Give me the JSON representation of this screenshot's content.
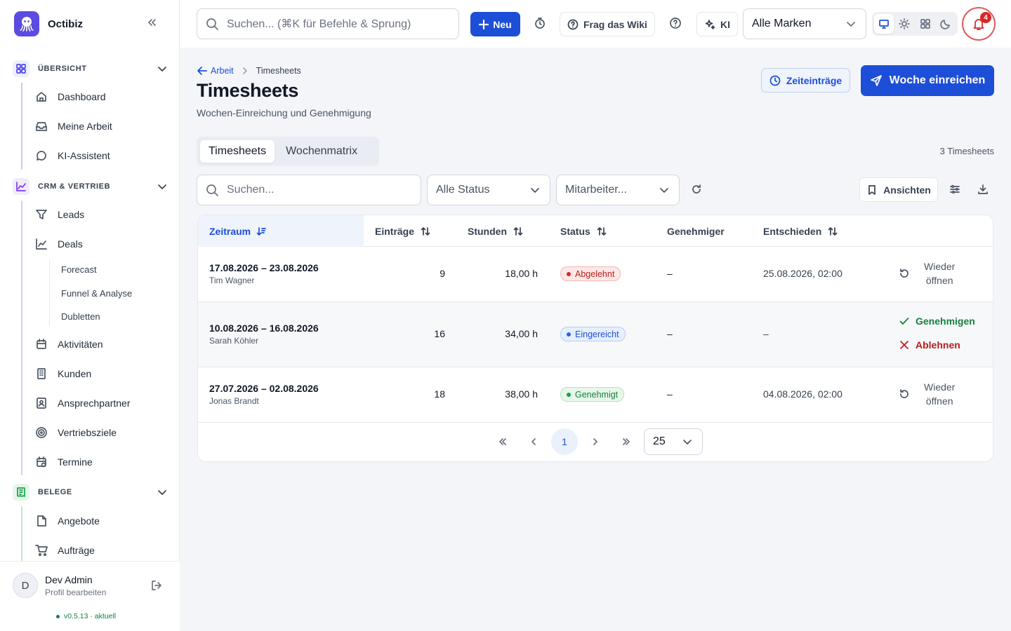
{
  "app": {
    "name": "Octibiz"
  },
  "sidebar": {
    "sections": [
      {
        "label": "ÜBERSICHT",
        "items": [
          "Dashboard",
          "Meine Arbeit",
          "KI-Assistent"
        ]
      },
      {
        "label": "CRM & VERTRIEB",
        "items": [
          "Leads",
          "Deals",
          "Aktivitäten",
          "Kunden",
          "Ansprechpartner",
          "Vertriebsziele",
          "Termine"
        ],
        "deals_sub": [
          "Forecast",
          "Funnel & Analyse",
          "Dubletten"
        ]
      },
      {
        "label": "BELEGE",
        "items": [
          "Angebote",
          "Aufträge"
        ]
      }
    ],
    "user": {
      "initial": "D",
      "name": "Dev Admin",
      "sub": "Profil bearbeiten"
    },
    "version": "v0.5.13 · aktuell"
  },
  "topbar": {
    "search_placeholder": "Suchen... (⌘K für Befehle & Sprung)",
    "new_label": "Neu",
    "wiki_label": "Frag das Wiki",
    "ai_label": "KI",
    "brand_select": "Alle Marken",
    "notification_count": "4"
  },
  "page": {
    "breadcrumb_parent": "Arbeit",
    "breadcrumb_current": "Timesheets",
    "title": "Timesheets",
    "subtitle": "Wochen-Einreichung und Genehmigung",
    "btn_entries": "Zeiteinträge",
    "btn_submit": "Woche einreichen",
    "tabs": [
      "Timesheets",
      "Wochenmatrix"
    ],
    "count": "3 Timesheets"
  },
  "filters": {
    "search_placeholder": "Suchen...",
    "status": "Alle Status",
    "employee": "Mitarbeiter...",
    "views": "Ansichten"
  },
  "table": {
    "headers": [
      "Zeitraum",
      "Einträge",
      "Stunden",
      "Status",
      "Genehmiger",
      "Entschieden"
    ],
    "rows": [
      {
        "period": "17.08.2026 – 23.08.2026",
        "person": "Tim Wagner",
        "entries": "9",
        "hours": "18,00 h",
        "status": "Abgelehnt",
        "approver": "–",
        "decided": "25.08.2026, 02:00",
        "action_1": "Wieder",
        "action_2": "öffnen"
      },
      {
        "period": "10.08.2026 – 16.08.2026",
        "person": "Sarah Köhler",
        "entries": "16",
        "hours": "34,00 h",
        "status": "Eingereicht",
        "approver": "–",
        "decided": "–",
        "approve": "Genehmigen",
        "reject": "Ablehnen"
      },
      {
        "period": "27.07.2026 – 02.08.2026",
        "person": "Jonas Brandt",
        "entries": "18",
        "hours": "38,00 h",
        "status": "Genehmigt",
        "approver": "–",
        "decided": "04.08.2026, 02:00",
        "action_1": "Wieder",
        "action_2": "öffnen"
      }
    ]
  },
  "pagination": {
    "current_page": "1",
    "per_page": "25"
  },
  "colors": {
    "primary": "#1d4ed8",
    "danger": "#dc2626",
    "success": "#15803d",
    "logo": "#5b4be0"
  }
}
